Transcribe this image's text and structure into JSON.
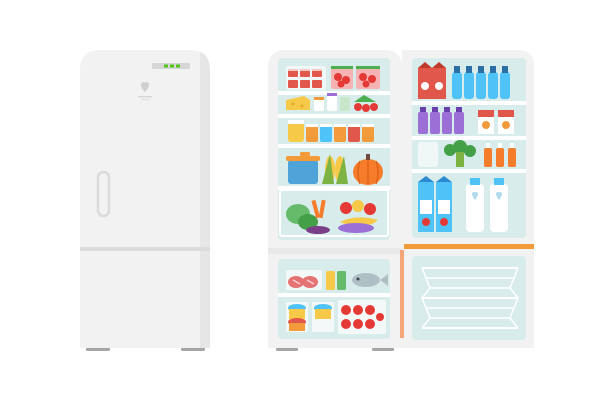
{
  "scene": {
    "closed_fridge": {
      "panel": {
        "display": "green-segment-display",
        "logo": "heart-logo"
      }
    },
    "open_fridge": {
      "main_shelves": [
        "dessert-cups",
        "cheese-and-jars",
        "yogurt-cups",
        "pot-corn-pumpkin",
        "vegetable-crisper-fruit"
      ],
      "freezer_items": [
        "steaks",
        "fish",
        "lollipops",
        "ice-cream-cups"
      ],
      "door_shelves": [
        "milk-cartons-and-bottles",
        "juice-bottles",
        "broccoli-and-sauce-bottles",
        "milk-carton-and-bottles"
      ],
      "freezer_door": "wire-basket"
    }
  },
  "colors": {
    "body": "#f2f2f2",
    "shadow": "#e2e2e2",
    "interior": "#d8ecec",
    "shelf": "#ffffff",
    "accent_orange": "#f39a3a",
    "door_edge": "#f5a57a",
    "display_green": "#52c41a"
  }
}
